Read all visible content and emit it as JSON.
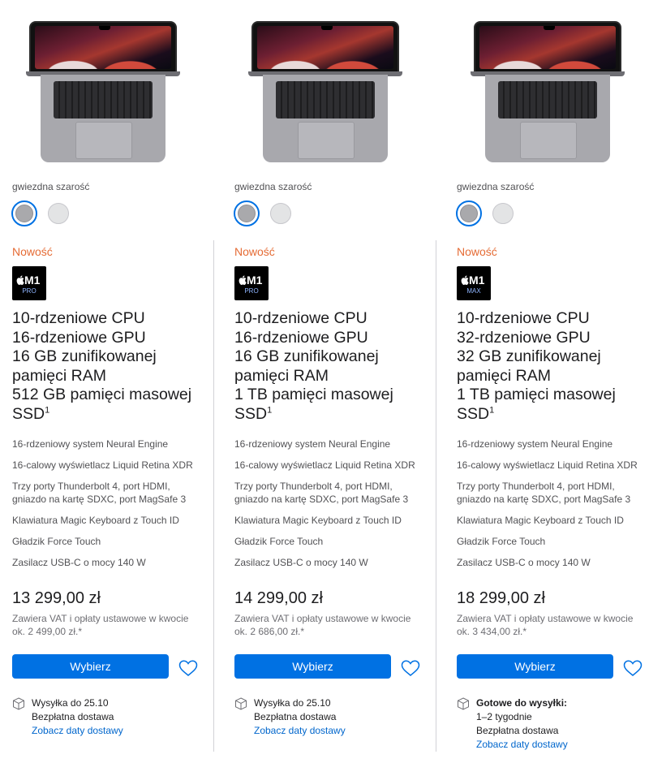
{
  "colors": {
    "accent": "#0071e3",
    "new_tag": "#e56b34",
    "link": "#0066cc"
  },
  "products": [
    {
      "color_label": "gwiezdna szarość",
      "swatches": [
        "gwiezdna szarość",
        "srebrny"
      ],
      "new_label": "Nowość",
      "chip": {
        "name": "M1",
        "tier": "PRO"
      },
      "heading": [
        "10-rdzeniowe CPU",
        "16-rdzeniowe GPU",
        "16 GB zunifikowanej",
        "pamięci RAM",
        "512 GB pamięci masowej",
        "SSD"
      ],
      "footnote": "1",
      "specs": [
        "16-rdzeniowy system Neural Engine",
        "16-calowy wyświetlacz Liquid Retina XDR",
        "Trzy porty Thunderbolt 4, port HDMI,",
        "gniazdo na kartę SDXC, port MagSafe 3",
        "Klawiatura Magic Keyboard z Touch ID",
        "Gładzik Force Touch",
        "Zasilacz USB-C o mocy 140 W"
      ],
      "price": "13 299,00 zł",
      "tax_line1": "Zawiera VAT i opłaty ustawowe w kwocie",
      "tax_line2": "ok. 2 499,00 zł.*",
      "select_label": "Wybierz",
      "shipping": [
        "Wysyłka do 25.10",
        "Bezpłatna dostawa"
      ],
      "delivery_link": "Zobacz daty dostawy"
    },
    {
      "color_label": "gwiezdna szarość",
      "swatches": [
        "gwiezdna szarość",
        "srebrny"
      ],
      "new_label": "Nowość",
      "chip": {
        "name": "M1",
        "tier": "PRO"
      },
      "heading": [
        "10-rdzeniowe CPU",
        "16-rdzeniowe GPU",
        "16 GB zunifikowanej",
        "pamięci RAM",
        "1 TB pamięci masowej",
        "SSD"
      ],
      "footnote": "1",
      "specs": [
        "16-rdzeniowy system Neural Engine",
        "16-calowy wyświetlacz Liquid Retina XDR",
        "Trzy porty Thunderbolt 4, port HDMI,",
        "gniazdo na kartę SDXC, port MagSafe 3",
        "Klawiatura Magic Keyboard z Touch ID",
        "Gładzik Force Touch",
        "Zasilacz USB-C o mocy 140 W"
      ],
      "price": "14 299,00 zł",
      "tax_line1": "Zawiera VAT i opłaty ustawowe w kwocie",
      "tax_line2": "ok. 2 686,00 zł.*",
      "select_label": "Wybierz",
      "shipping": [
        "Wysyłka do 25.10",
        "Bezpłatna dostawa"
      ],
      "delivery_link": "Zobacz daty dostawy"
    },
    {
      "color_label": "gwiezdna szarość",
      "swatches": [
        "gwiezdna szarość",
        "srebrny"
      ],
      "new_label": "Nowość",
      "chip": {
        "name": "M1",
        "tier": "MAX"
      },
      "heading": [
        "10-rdzeniowe CPU",
        "32-rdzeniowe GPU",
        "32 GB zunifikowanej",
        "pamięci RAM",
        "1 TB pamięci masowej",
        "SSD"
      ],
      "footnote": "1",
      "specs": [
        "16-rdzeniowy system Neural Engine",
        "16-calowy wyświetlacz Liquid Retina XDR",
        "Trzy porty Thunderbolt 4, port HDMI,",
        "gniazdo na kartę SDXC, port MagSafe 3",
        "Klawiatura Magic Keyboard z Touch ID",
        "Gładzik Force Touch",
        "Zasilacz USB-C o mocy 140 W"
      ],
      "price": "18 299,00 zł",
      "tax_line1": "Zawiera VAT i opłaty ustawowe w kwocie",
      "tax_line2": "ok. 3 434,00 zł.*",
      "select_label": "Wybierz",
      "shipping_title": "Gotowe do wysyłki:",
      "shipping": [
        "1–2 tygodnie",
        "Bezpłatna dostawa"
      ],
      "delivery_link": "Zobacz daty dostawy"
    }
  ]
}
